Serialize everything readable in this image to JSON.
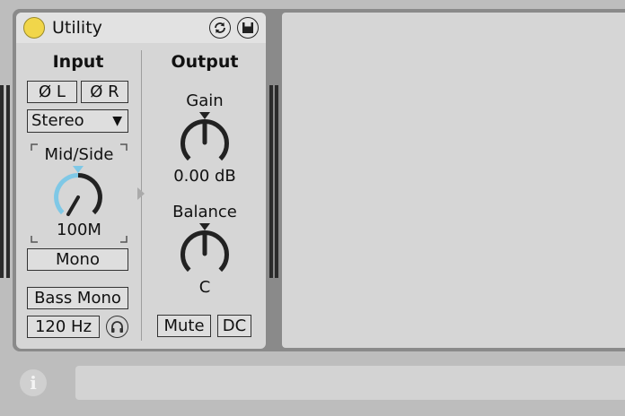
{
  "device": {
    "title": "Utility",
    "input": {
      "header": "Input",
      "phase_left": "Ø L",
      "phase_right": "Ø R",
      "channel_mode": "Stereo",
      "mid_side_label": "Mid/Side",
      "mid_side_value": "100M",
      "mid_side_level": 1.0,
      "mono_label": "Mono",
      "bass_mono_label": "Bass Mono",
      "bass_mono_freq": "120 Hz"
    },
    "output": {
      "header": "Output",
      "gain_label": "Gain",
      "gain_value": "0.00 dB",
      "balance_label": "Balance",
      "balance_value": "C",
      "mute_label": "Mute",
      "dc_label": "DC"
    }
  },
  "colors": {
    "power_on": "#f1d64a",
    "accent_blue": "#7fc8e6"
  },
  "icons": {
    "hot_swap": "hot-swap-icon",
    "save_preset": "save-icon",
    "headphones": "headphones-icon",
    "info": "info-icon"
  },
  "info_symbol": "i"
}
